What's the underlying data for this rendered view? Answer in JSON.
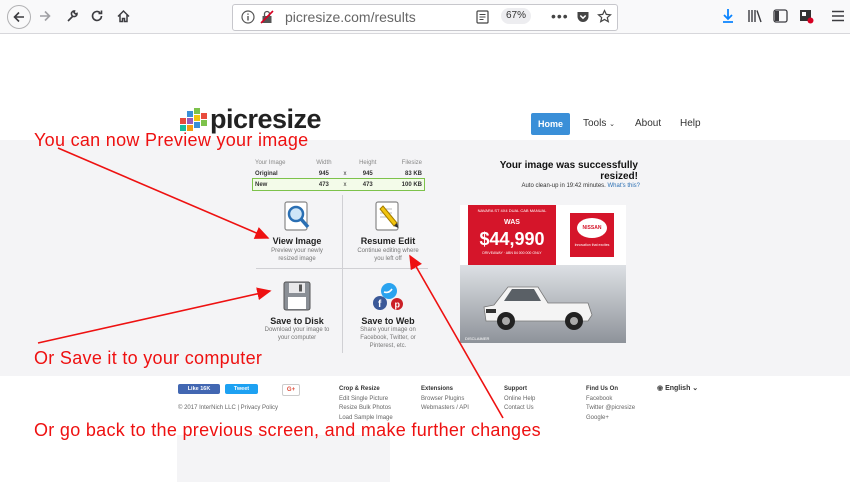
{
  "browser": {
    "url": "picresize.com/results",
    "zoom": "67%"
  },
  "site": {
    "logo": "picresize",
    "nav": [
      "Home",
      "Tools",
      "About",
      "Help"
    ]
  },
  "size_table": {
    "headers": [
      "Your Image",
      "Width",
      "",
      "Height",
      "Filesize"
    ],
    "rows": [
      [
        "Original",
        "945",
        "x",
        "945",
        "83 KB"
      ],
      [
        "New",
        "473",
        "x",
        "473",
        "100 KB"
      ]
    ]
  },
  "tiles": [
    {
      "title": "View Image",
      "desc": "Preview your newly resized image"
    },
    {
      "title": "Resume Edit",
      "desc": "Continue editing where you left off"
    },
    {
      "title": "Save to Disk",
      "desc": "Download your image to your computer"
    },
    {
      "title": "Save to Web",
      "desc": "Share your image on Facebook, Twitter, or Pinterest, etc."
    }
  ],
  "result": {
    "title": "Your image was successfully resized!",
    "autoclean": "Auto clean-up in 19:42 minutes.",
    "autoclean_link": "What's this?"
  },
  "ad": {
    "was": "WAS",
    "price": "$44,990",
    "brand": "NISSAN",
    "top_text": "NAVARA ST 4X4 DUAL CAB MANUAL",
    "small_text": "DRIVEAWAY · ABN 84 000 000 ONLY",
    "tagline": "Innovation that excites",
    "disclaimer": "DISCLAIMER"
  },
  "footer": {
    "social": {
      "like": "Like 16K",
      "tweet": "Tweet",
      "gplus": "G+"
    },
    "copyright": "© 2017 InterNich LLC | Privacy Policy",
    "columns": [
      {
        "title": "Crop & Resize",
        "links": [
          "Edit Single Picture",
          "Resize Bulk Photos",
          "Load Sample Image"
        ]
      },
      {
        "title": "Extensions",
        "links": [
          "Browser Plugins",
          "Webmasters / API"
        ]
      },
      {
        "title": "Support",
        "links": [
          "Online Help",
          "Contact Us"
        ]
      },
      {
        "title": "Find Us On",
        "links": [
          "Facebook",
          "Twitter @picresize",
          "Google+"
        ]
      }
    ],
    "language": "English"
  },
  "annotations": [
    "You can now Preview your image",
    "Or Save it to your computer",
    "Or go back to the previous screen, and make further changes"
  ],
  "colors": {
    "annotation": "#ee1111",
    "home_button": "#3a8fd8",
    "new_row_border": "#7dc24b"
  }
}
